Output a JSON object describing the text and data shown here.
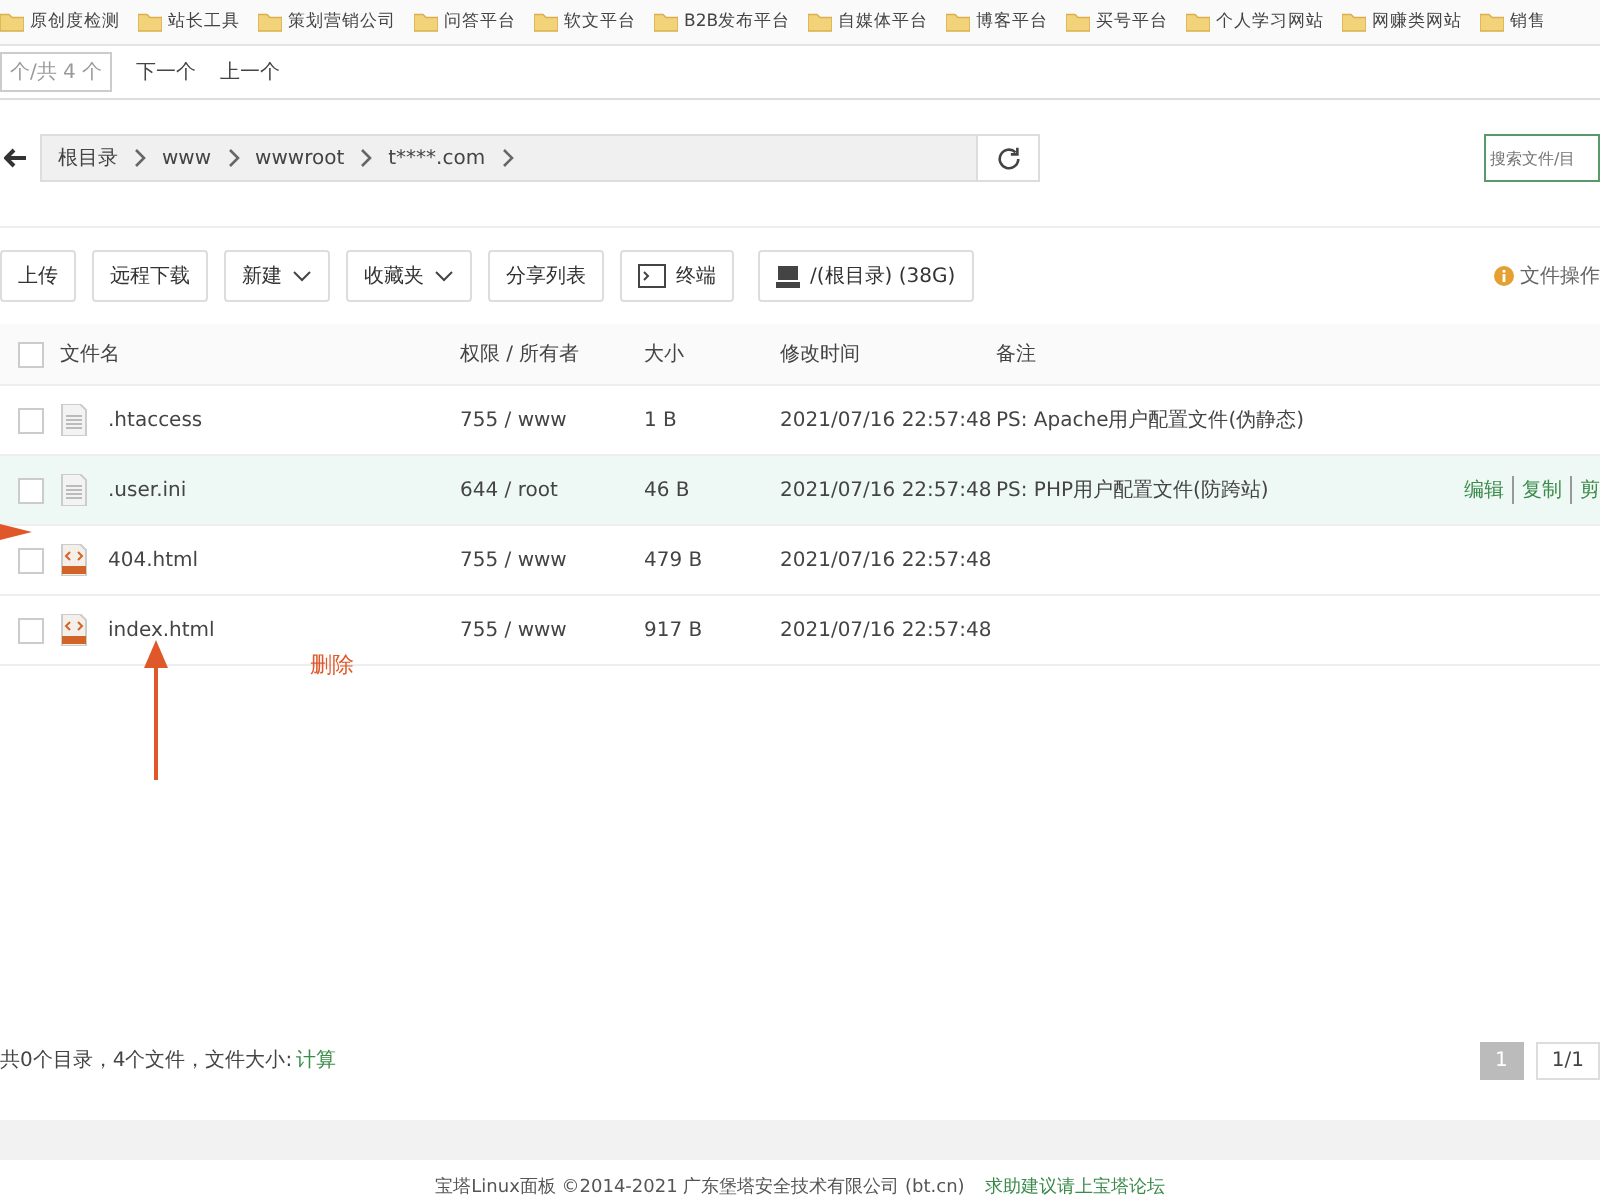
{
  "bookmarks": [
    "原创度检测",
    "站长工具",
    "策划营销公司",
    "问答平台",
    "软文平台",
    "B2B发布平台",
    "自媒体平台",
    "博客平台",
    "买号平台",
    "个人学习网站",
    "网赚类网站",
    "销售"
  ],
  "find_bar": {
    "count": "个/共 4 个",
    "next": "下一个",
    "prev": "上一个"
  },
  "breadcrumb": [
    "根目录",
    "www",
    "wwwroot",
    "t****.com"
  ],
  "search": {
    "placeholder": "搜索文件/目"
  },
  "toolbar": [
    {
      "label": "上传",
      "kind": "plain"
    },
    {
      "label": "远程下载",
      "kind": "plain"
    },
    {
      "label": "新建",
      "kind": "dropdown"
    },
    {
      "label": "收藏夹",
      "kind": "dropdown"
    },
    {
      "label": "分享列表",
      "kind": "plain"
    },
    {
      "label": "终端",
      "kind": "terminal"
    },
    {
      "label": "/(根目录) (38G)",
      "kind": "disk"
    }
  ],
  "help_link": "文件操作",
  "table": {
    "select_all": {
      "checked": false
    },
    "columns": [
      "文件名",
      "权限 / 所有者",
      "大小",
      "修改时间",
      "备注"
    ],
    "rows": [
      {
        "name": ".htaccess",
        "kind": "text",
        "perm": "755 / www",
        "size": "1 B",
        "checked": false,
        "time": "2021/07/16 22:57:48",
        "note": "PS: Apache用户配置文件(伪静态)",
        "highlighted": false
      },
      {
        "name": ".user.ini",
        "kind": "text",
        "perm": "644 / root",
        "size": "46 B",
        "checked": false,
        "time": "2021/07/16 22:57:48",
        "note": "PS: PHP用户配置文件(防跨站)",
        "highlighted": true,
        "actions": [
          "编辑",
          "复制",
          "剪"
        ]
      },
      {
        "name": "404.html",
        "kind": "html",
        "perm": "755 / www",
        "size": "479 B",
        "checked": false,
        "time": "2021/07/16 22:57:48",
        "highlighted": false
      },
      {
        "name": "index.html",
        "kind": "html",
        "perm": "755 / www",
        "size": "917 B",
        "checked": false,
        "time": "2021/07/16 22:57:48",
        "highlighted": false
      }
    ]
  },
  "annotation": {
    "label": "删除"
  },
  "summary": {
    "text": "共0个目录，4个文件，文件大小: ",
    "link": "计算"
  },
  "pagination": [
    {
      "label": "1",
      "selected": true
    },
    {
      "label": "1/1",
      "selected": false
    }
  ],
  "footer": {
    "text": "宝塔Linux面板 ©2014-2021 广东堡塔安全技术有限公司 (bt.cn)",
    "link": "求助建议请上宝塔论坛"
  }
}
